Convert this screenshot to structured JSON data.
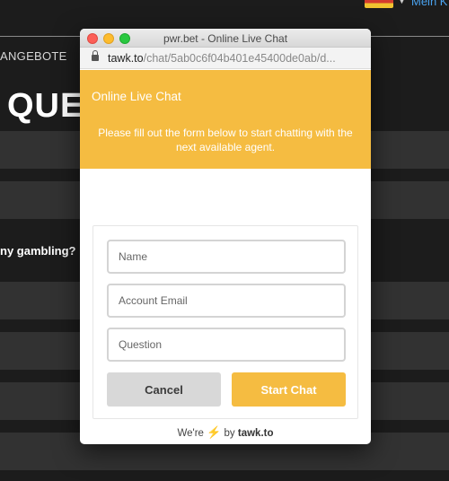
{
  "background": {
    "flag_icon": "germany-flag-icon",
    "language_link": "Mein K",
    "nav_item": "ANGEBOTE",
    "heading": "QUES",
    "question_row": "ny gambling?"
  },
  "window": {
    "title": "pwr.bet - Online Live Chat",
    "url_host": "tawk.to",
    "url_path": "/chat/5ab0c6f04b401e45400de0ab/d..."
  },
  "chat": {
    "title": "Online Live Chat",
    "subtitle": "Please fill out the form below to start chatting with the next available agent."
  },
  "form": {
    "name_placeholder": "Name",
    "email_placeholder": "Account Email",
    "question_placeholder": "Question",
    "cancel_label": "Cancel",
    "start_label": "Start Chat"
  },
  "footer": {
    "prefix": "We're",
    "by": "by",
    "brand": "tawk.to"
  },
  "colors": {
    "accent": "#f5bc41",
    "cancel_bg": "#d8d8d8",
    "page_bg": "#1c1c1c"
  }
}
